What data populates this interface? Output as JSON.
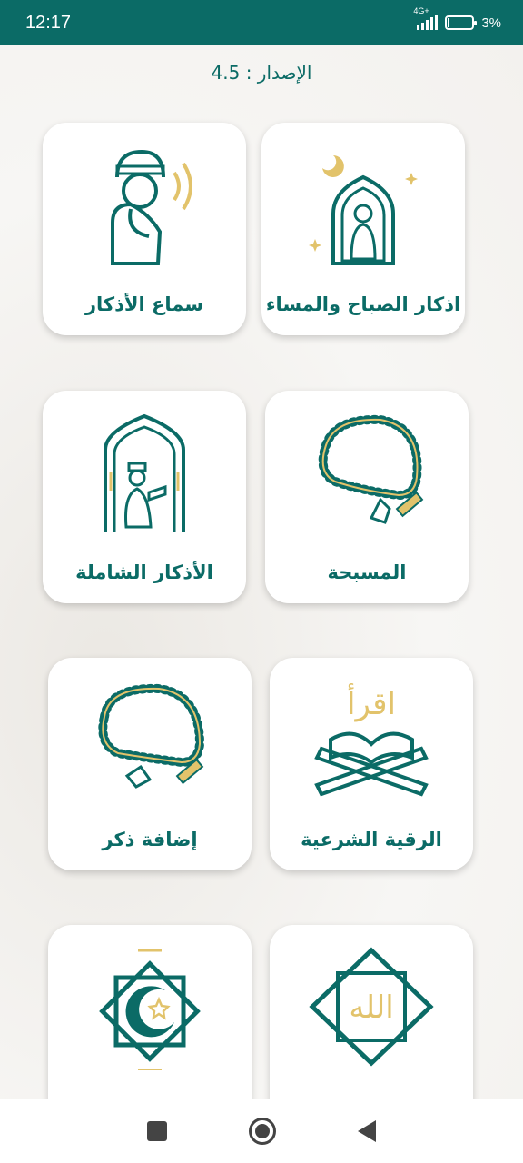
{
  "status": {
    "time": "12:17",
    "network": "4G+",
    "battery": "3%",
    "battery_level": 0.03
  },
  "version_label": "الإصدار : 4.5",
  "cards": [
    {
      "label": "اذكار الصباح والمساء",
      "icon": "praying-man-mihrab-icon"
    },
    {
      "label": "سماع الأذكار",
      "icon": "listening-man-icon"
    },
    {
      "label": "المسبحة",
      "icon": "prayer-beads-icon"
    },
    {
      "label": "الأذكار الشاملة",
      "icon": "reading-man-mihrab-icon"
    },
    {
      "label": "الرقية الشرعية",
      "icon": "quran-stand-icon"
    },
    {
      "label": "إضافة ذكر",
      "icon": "prayer-beads-icon"
    },
    {
      "label": "",
      "icon": "allah-calligraphy-icon"
    },
    {
      "label": "",
      "icon": "crescent-star-icon"
    }
  ],
  "colors": {
    "teal": "#0b6b66",
    "gold": "#e2c36b"
  }
}
